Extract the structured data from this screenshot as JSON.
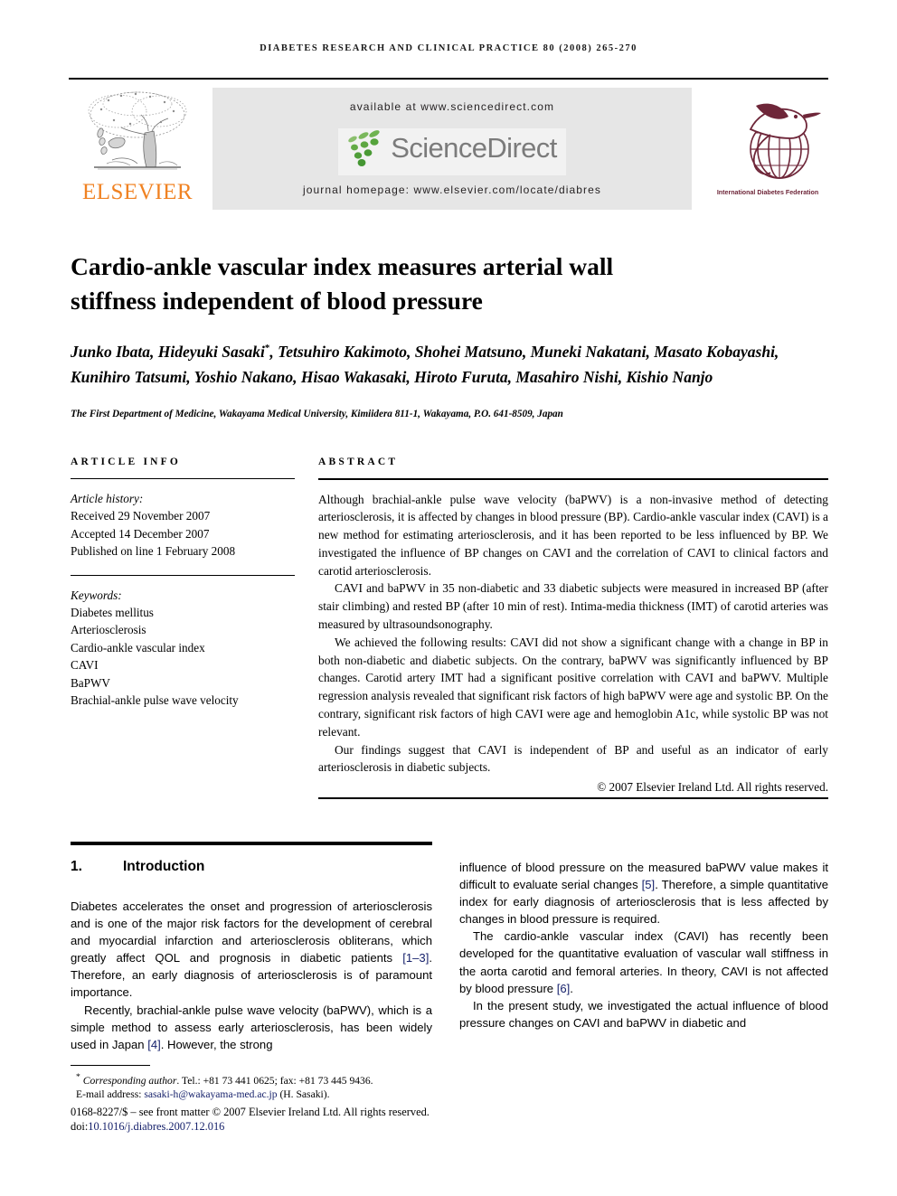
{
  "running_head": "DIABETES RESEARCH AND CLINICAL PRACTICE 80 (2008) 265-270",
  "banner": {
    "elsevier_wordmark": "ELSEVIER",
    "available_at": "available at www.sciencedirect.com",
    "sciencedirect_wordmark": "ScienceDirect",
    "journal_homepage": "journal homepage: www.elsevier.com/locate/diabres",
    "idf_caption": "International Diabetes Federation"
  },
  "article": {
    "title": "Cardio-ankle vascular index measures arterial wall stiffness independent of blood pressure",
    "authors": "Junko Ibata, Hideyuki Sasaki",
    "authors_rest": ", Tetsuhiro Kakimoto, Shohei Matsuno, Muneki Nakatani, Masato Kobayashi, Kunihiro Tatsumi, Yoshio Nakano, Hisao Wakasaki, Hiroto Furuta, Masahiro Nishi, Kishio Nanjo",
    "corresponding_marker": "*",
    "affiliation": "The First Department of Medicine, Wakayama Medical University, Kimiidera 811-1, Wakayama, P.O. 641-8509, Japan"
  },
  "article_info": {
    "heading": "ARTICLE INFO",
    "history_label": "Article history:",
    "history": [
      "Received 29 November 2007",
      "Accepted 14 December 2007",
      "Published on line 1 February 2008"
    ],
    "keywords_label": "Keywords:",
    "keywords": [
      "Diabetes mellitus",
      "Arteriosclerosis",
      "Cardio-ankle vascular index",
      "CAVI",
      "BaPWV",
      "Brachial-ankle pulse wave velocity"
    ]
  },
  "abstract": {
    "heading": "ABSTRACT",
    "paragraphs": [
      "Although brachial-ankle pulse wave velocity (baPWV) is a non-invasive method of detecting arteriosclerosis, it is affected by changes in blood pressure (BP). Cardio-ankle vascular index (CAVI) is a new method for estimating arteriosclerosis, and it has been reported to be less influenced by BP. We investigated the influence of BP changes on CAVI and the correlation of CAVI to clinical factors and carotid arteriosclerosis.",
      "CAVI and baPWV in 35 non-diabetic and 33 diabetic subjects were measured in increased BP (after stair climbing) and rested BP (after 10 min of rest). Intima-media thickness (IMT) of carotid arteries was measured by ultrasoundsonography.",
      "We achieved the following results: CAVI did not show a significant change with a change in BP in both non-diabetic and diabetic subjects. On the contrary, baPWV was significantly influenced by BP changes. Carotid artery IMT had a significant positive correlation with CAVI and baPWV. Multiple regression analysis revealed that significant risk factors of high baPWV were age and systolic BP. On the contrary, significant risk factors of high CAVI were age and hemoglobin A1c, while systolic BP was not relevant.",
      "Our findings suggest that CAVI is independent of BP and useful as an indicator of early arteriosclerosis in diabetic subjects."
    ],
    "copyright": "© 2007 Elsevier Ireland Ltd. All rights reserved."
  },
  "introduction": {
    "number": "1.",
    "heading": "Introduction",
    "left_paragraphs": [
      {
        "prefix": "Diabetes accelerates the onset and progression of arteriosclerosis and is one of the major risk factors for the development of cerebral and myocardial infarction and arteriosclerosis obliterans, which greatly affect QOL and prognosis in diabetic patients ",
        "cite": "[1–3]",
        "suffix": ". Therefore, an early diagnosis of arteriosclerosis is of paramount importance."
      },
      {
        "prefix": "Recently, brachial-ankle pulse wave velocity (baPWV), which is a simple method to assess early arteriosclerosis, has been widely used in Japan ",
        "cite": "[4]",
        "suffix": ". However, the strong"
      }
    ],
    "right_paragraphs": [
      {
        "prefix": "influence of blood pressure on the measured baPWV value makes it difficult to evaluate serial changes ",
        "cite": "[5]",
        "suffix": ". Therefore, a simple quantitative index for early diagnosis of arteriosclerosis that is less affected by changes in blood pressure is required."
      },
      {
        "prefix": "The cardio-ankle vascular index (CAVI) has recently been developed for the quantitative evaluation of vascular wall stiffness in the aorta carotid and femoral arteries. In theory, CAVI is not affected by blood pressure ",
        "cite": "[6]",
        "suffix": "."
      },
      {
        "prefix": "In the present study, we investigated the actual influence of blood pressure changes on CAVI and baPWV in diabetic and",
        "cite": "",
        "suffix": ""
      }
    ]
  },
  "footnote": {
    "marker": "*",
    "corresponding_italic": "Corresponding author",
    "corresponding_rest": ". Tel.: +81 73 441 0625; fax: +81 73 445 9436.",
    "email_label": "E-mail address:",
    "email": "sasaki-h@wakayama-med.ac.jp",
    "email_suffix": "(H. Sasaki).",
    "issn_line": "0168-8227/$ – see front matter © 2007 Elsevier Ireland Ltd. All rights reserved.",
    "doi_prefix": "doi:",
    "doi": "10.1016/j.diabres.2007.12.016"
  },
  "colors": {
    "elsevier_orange": "#F08222",
    "sciencedirect_gray": "#7b7b7b",
    "sciencedirect_green": "#5a9e43",
    "idf_maroon": "#6e2639",
    "link_blue": "#16216b",
    "band_gray": "#e6e6e6"
  }
}
